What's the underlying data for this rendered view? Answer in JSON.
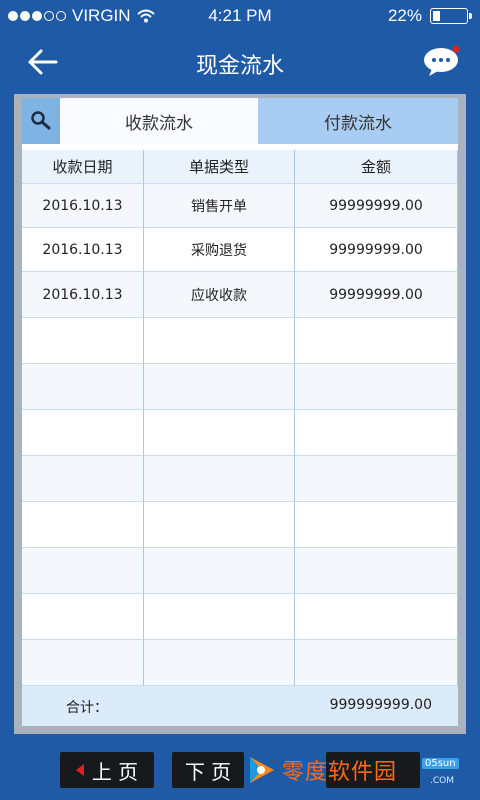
{
  "status": {
    "carrier": "VIRGIN",
    "time": "4:21 PM",
    "battery": "22%",
    "battery_level": 0.22
  },
  "nav": {
    "title": "现金流水"
  },
  "tabs": [
    {
      "label": "收款流水",
      "active": true
    },
    {
      "label": "付款流水",
      "active": false
    }
  ],
  "table": {
    "headers": [
      "收款日期",
      "单据类型",
      "金额"
    ],
    "rows": [
      [
        "2016.10.13",
        "销售开单",
        "99999999.00"
      ],
      [
        "2016.10.13",
        "采购退货",
        "99999999.00"
      ],
      [
        "2016.10.13",
        "应收收款",
        "99999999.00"
      ],
      [
        "",
        "",
        ""
      ],
      [
        "",
        "",
        ""
      ],
      [
        "",
        "",
        ""
      ],
      [
        "",
        "",
        ""
      ],
      [
        "",
        "",
        ""
      ],
      [
        "",
        "",
        ""
      ],
      [
        "",
        "",
        ""
      ],
      [
        "",
        "",
        ""
      ]
    ]
  },
  "footer": {
    "label": "合计：",
    "total": "999999999.00"
  },
  "bottom": {
    "prev": "上 页",
    "next": "下 页"
  },
  "watermark": {
    "text": "零度软件园",
    "badge": "05sun",
    "domain": ".COM"
  },
  "colors": {
    "primary": "#1f5aa6",
    "tab_active": "#f8fbff",
    "tab_inactive": "#a9cdf2",
    "accent_red": "#e02020"
  }
}
